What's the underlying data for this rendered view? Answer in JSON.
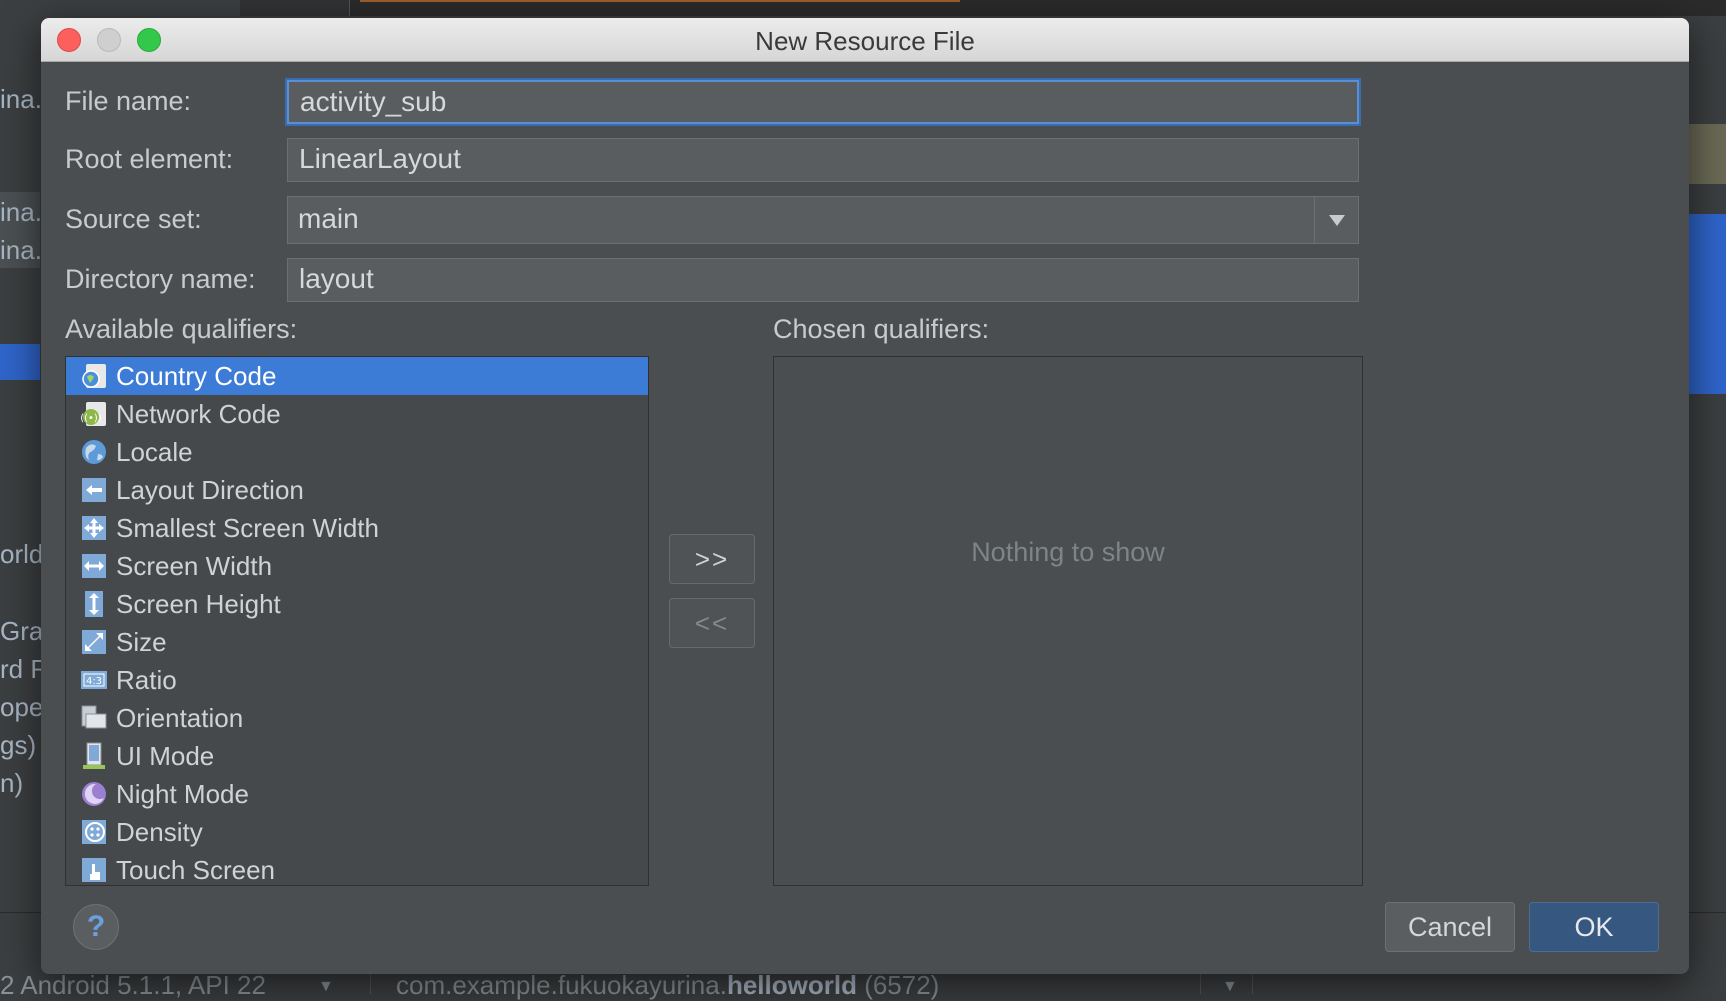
{
  "background_ide": {
    "left_fragments": [
      "ina.",
      "ina.",
      "ina.",
      "orld",
      "Gra",
      "rd R",
      "ope",
      "gs)",
      "n)"
    ],
    "bottom_device": "2 Android 5.1.1, API 22",
    "bottom_process_prefix": "com.example.fukuokayurina.",
    "bottom_process_bold": "helloworld",
    "bottom_process_pid": "(6572)"
  },
  "dialog": {
    "title": "New Resource File",
    "fields": {
      "file_name": {
        "label": "File name:",
        "value": "activity_sub"
      },
      "root_element": {
        "label": "Root element:",
        "value": "LinearLayout"
      },
      "source_set": {
        "label": "Source set:",
        "value": "main"
      },
      "directory_name": {
        "label": "Directory name:",
        "value": "layout"
      }
    },
    "available_label": "Available qualifiers:",
    "chosen_label": "Chosen qualifiers:",
    "qualifiers": [
      {
        "label": "Country Code",
        "icon": "country-code-icon",
        "selected": true
      },
      {
        "label": "Network Code",
        "icon": "network-code-icon",
        "selected": false
      },
      {
        "label": "Locale",
        "icon": "globe-icon",
        "selected": false
      },
      {
        "label": "Layout Direction",
        "icon": "layout-direction-icon",
        "selected": false
      },
      {
        "label": "Smallest Screen Width",
        "icon": "smallest-width-icon",
        "selected": false
      },
      {
        "label": "Screen Width",
        "icon": "screen-width-icon",
        "selected": false
      },
      {
        "label": "Screen Height",
        "icon": "screen-height-icon",
        "selected": false
      },
      {
        "label": "Size",
        "icon": "size-icon",
        "selected": false
      },
      {
        "label": "Ratio",
        "icon": "ratio-icon",
        "selected": false
      },
      {
        "label": "Orientation",
        "icon": "orientation-icon",
        "selected": false
      },
      {
        "label": "UI Mode",
        "icon": "ui-mode-icon",
        "selected": false
      },
      {
        "label": "Night Mode",
        "icon": "night-mode-icon",
        "selected": false
      },
      {
        "label": "Density",
        "icon": "density-icon",
        "selected": false
      },
      {
        "label": "Touch Screen",
        "icon": "touch-screen-icon",
        "selected": false
      }
    ],
    "add_button": ">>",
    "remove_button": "<<",
    "chosen_empty_text": "Nothing to show",
    "help_button": "?",
    "cancel_button": "Cancel",
    "ok_button": "OK"
  },
  "colors": {
    "selection": "#3d7cd6",
    "dialog_bg": "#4a4e51",
    "ok_bg": "#365880",
    "focus_ring": "#5b8fd3"
  }
}
